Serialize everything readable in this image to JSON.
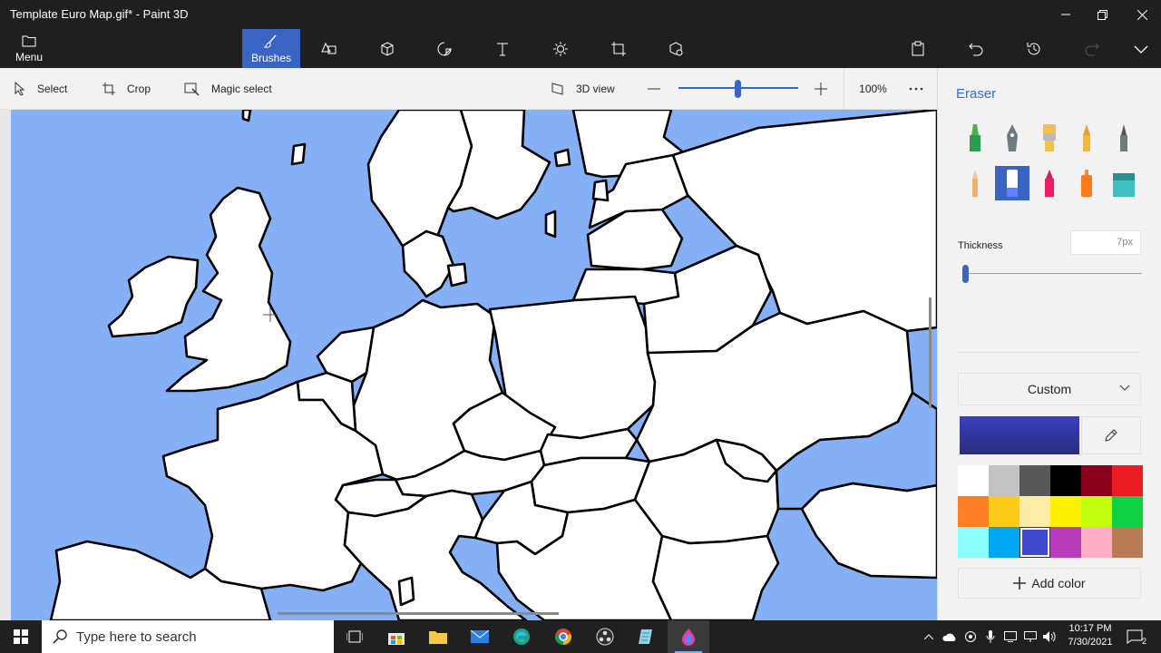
{
  "window": {
    "title": "Template Euro Map.gif* - Paint 3D"
  },
  "toolbar": {
    "menu_label": "Menu",
    "tools": [
      {
        "name": "brushes",
        "label": "Brushes",
        "active": true
      },
      {
        "name": "2d-shapes",
        "label": ""
      },
      {
        "name": "3d-shapes",
        "label": ""
      },
      {
        "name": "stickers",
        "label": ""
      },
      {
        "name": "text",
        "label": ""
      },
      {
        "name": "effects",
        "label": ""
      },
      {
        "name": "canvas",
        "label": ""
      },
      {
        "name": "3d-library",
        "label": ""
      }
    ]
  },
  "subbar": {
    "select_label": "Select",
    "crop_label": "Crop",
    "magic_select_label": "Magic select",
    "view3d_label": "3D view",
    "zoom_value": "100%",
    "zoom_fraction": 0.5
  },
  "panel": {
    "title": "Eraser",
    "brushes": [
      "marker",
      "calligraphy-pen",
      "oil-brush",
      "watercolor",
      "pixel-pen",
      "pencil",
      "eraser",
      "crayon",
      "spray-can",
      "fill"
    ],
    "selected_brush": "eraser",
    "thickness_label": "Thickness",
    "thickness_value": "7px",
    "thickness_fraction": 0.02,
    "color_mode": "Custom",
    "current_color": "#3b3fc0",
    "palette": [
      "#ffffff",
      "#c3c3c3",
      "#585858",
      "#000000",
      "#88001b",
      "#ec1c24",
      "#ff7f27",
      "#ffca18",
      "#fdeca6",
      "#fff200",
      "#c4ff0e",
      "#0ed145",
      "#8cfffb",
      "#00a8f3",
      "#3f48cc",
      "#b83dba",
      "#ffaec8",
      "#b97a56"
    ],
    "selected_swatch": 14,
    "add_color_label": "Add color"
  },
  "taskbar": {
    "search_placeholder": "Type here to search",
    "time": "10:17 PM",
    "date": "7/30/2021",
    "notification_count": "2"
  },
  "colors": {
    "accent": "#3a64c4",
    "sea": "#85b0f5"
  }
}
